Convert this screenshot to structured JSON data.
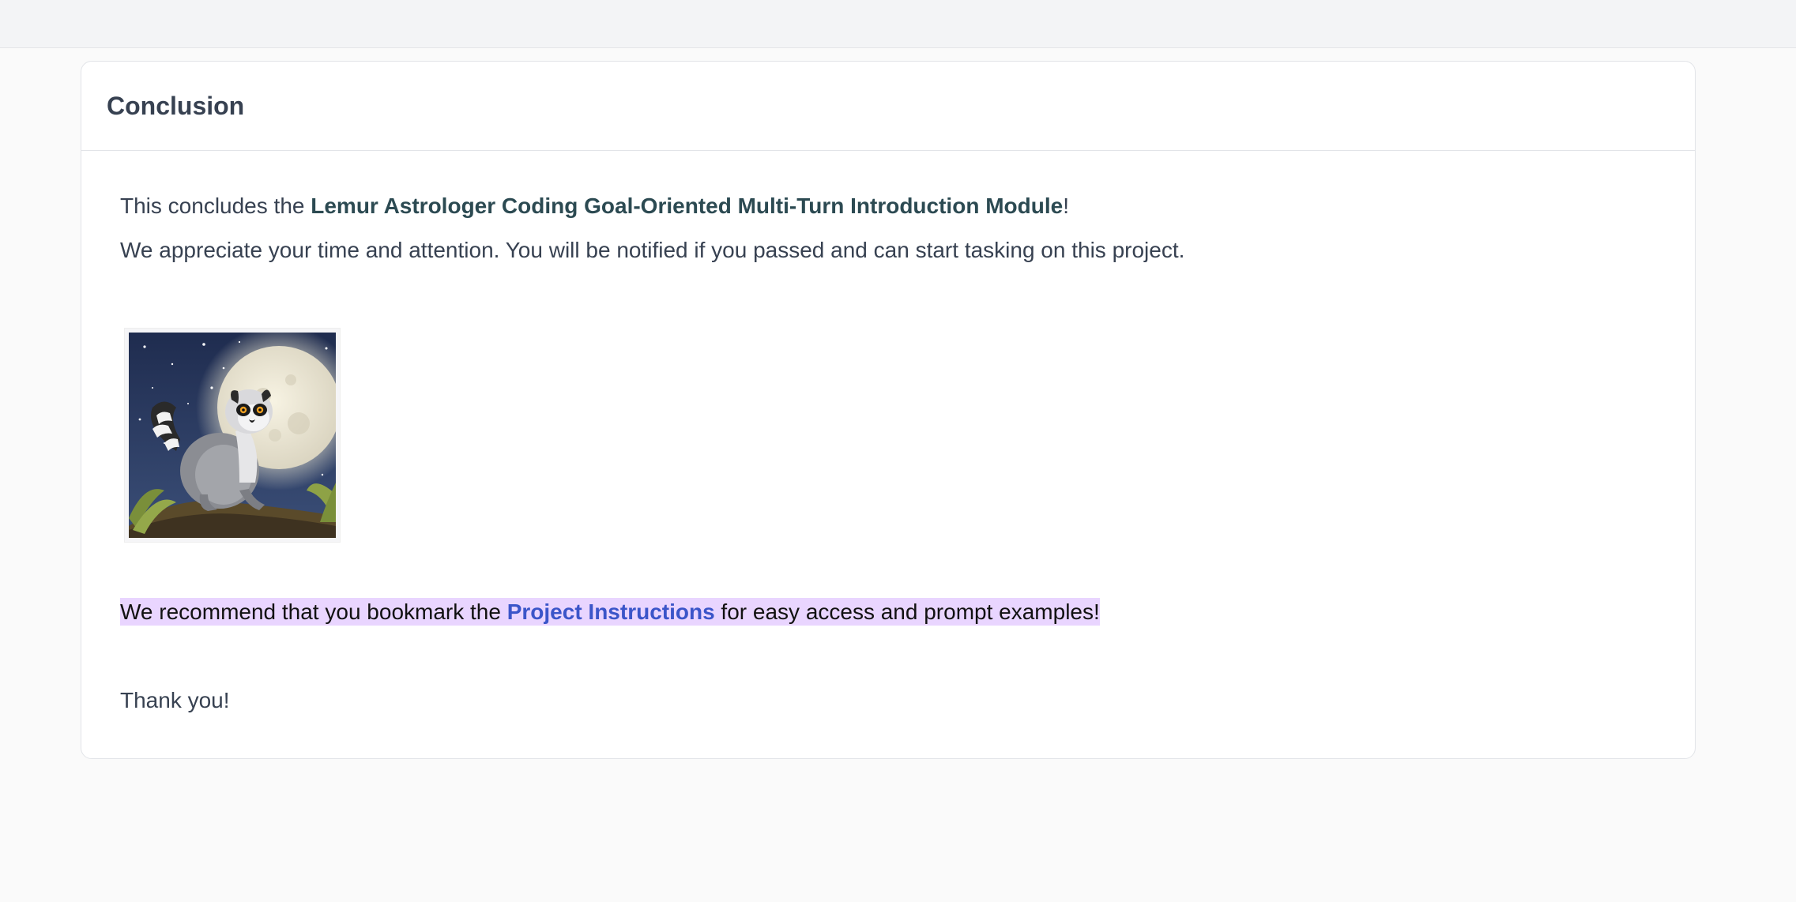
{
  "card": {
    "title": "Conclusion"
  },
  "body": {
    "intro_prefix": "This concludes the ",
    "module_name": "Lemur Astrologer Coding Goal-Oriented Multi-Turn Introduction Module",
    "intro_suffix": "!",
    "appreciate_text": "We appreciate your time and attention. You will be notified if you passed and can start tasking on this project.",
    "recommend_prefix": "We recommend that you bookmark the ",
    "project_link_text": "Project Instructions",
    "recommend_suffix": " for easy access and prompt examples!",
    "thanks_text": "Thank you!"
  },
  "image": {
    "subject": "lemur-under-full-moon-illustration"
  }
}
